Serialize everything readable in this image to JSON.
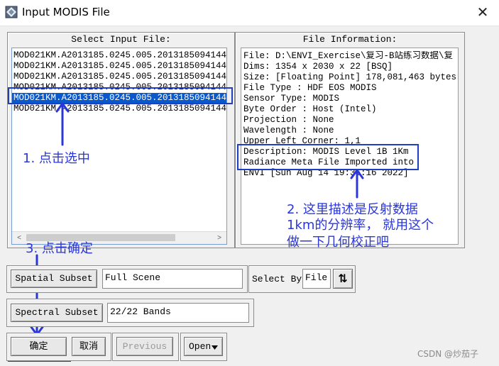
{
  "window": {
    "title": "Input MODIS File",
    "close_glyph": "✕"
  },
  "select_panel": {
    "title": "Select Input File:",
    "files": [
      "MOD021KM.A2013185.0245.005.2013185094144",
      "MOD021KM.A2013185.0245.005.2013185094144",
      "MOD021KM.A2013185.0245.005.2013185094144",
      "MOD021KM.A2013185.0245.005.2013185094144",
      "MOD021KM.A2013185.0245.005.2013185094144",
      "MOD021KM.A2013185.0245.005.2013185094144"
    ],
    "selected_index": 4,
    "scroll_left": "<",
    "scroll_right": ">"
  },
  "info_panel": {
    "title": "File Information:",
    "lines": [
      "File: D:\\ENVI_Exercise\\复习-B站练习数据\\复",
      "Dims: 1354 x 2030 x 22 [BSQ]",
      "Size: [Floating Point] 178,081,463 bytes.",
      "File Type  : HDF EOS MODIS",
      "Sensor Type: MODIS",
      "Byte Order : Host (Intel)",
      "Projection : None",
      "Wavelength : None",
      "Upper Left Corner: 1,1",
      "Description: MODIS Level 1B 1Km",
      "Radiance Meta File Imported into",
      "ENVI [Sun Aug 14 19:36:16 2022]"
    ]
  },
  "annotations": {
    "step1": "1. 点击选中",
    "step2_lines": [
      "2. 这里描述是反射数据",
      "1km的分辨率， 就用这个",
      "做一下几何校正吧"
    ],
    "step3": "3. 点击确定"
  },
  "spatial_subset": {
    "button": "Spatial Subset",
    "value": "Full Scene"
  },
  "select_by": {
    "label": "Select By",
    "value": "File",
    "sort_icon": "⇅"
  },
  "spectral_subset": {
    "button": "Spectral Subset",
    "value": "22/22 Bands"
  },
  "buttons": {
    "ok": "确定",
    "cancel": "取消",
    "previous": "Previous",
    "open": "Open"
  },
  "watermark": "CSDN @炒茄子",
  "colors": {
    "selection": "#0a58ca",
    "annotation": "#2a36d8",
    "annotation_box": "#1f3fbf"
  }
}
